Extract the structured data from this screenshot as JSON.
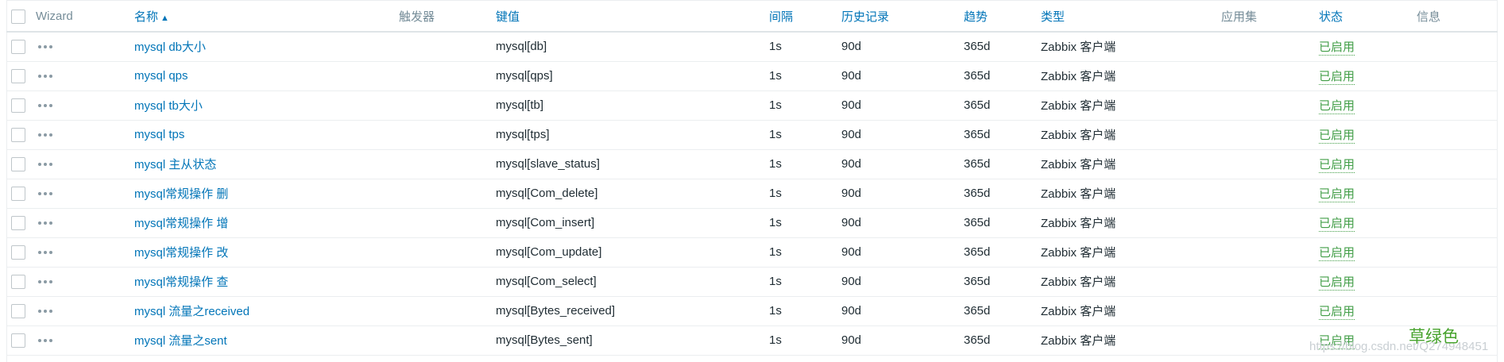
{
  "header": {
    "wizard": "Wizard",
    "name": "名称",
    "name_sort": "▲",
    "triggers": "触发器",
    "key": "键值",
    "interval": "间隔",
    "history": "历史记录",
    "trends": "趋势",
    "type": "类型",
    "applications": "应用集",
    "status": "状态",
    "info": "信息"
  },
  "rows": [
    {
      "name": "mysql db大小",
      "key": "mysql[db]",
      "interval": "1s",
      "history": "90d",
      "trends": "365d",
      "type": "Zabbix 客户端",
      "status": "已启用"
    },
    {
      "name": "mysql qps",
      "key": "mysql[qps]",
      "interval": "1s",
      "history": "90d",
      "trends": "365d",
      "type": "Zabbix 客户端",
      "status": "已启用"
    },
    {
      "name": "mysql tb大小",
      "key": "mysql[tb]",
      "interval": "1s",
      "history": "90d",
      "trends": "365d",
      "type": "Zabbix 客户端",
      "status": "已启用"
    },
    {
      "name": "mysql tps",
      "key": "mysql[tps]",
      "interval": "1s",
      "history": "90d",
      "trends": "365d",
      "type": "Zabbix 客户端",
      "status": "已启用"
    },
    {
      "name": "mysql 主从状态",
      "key": "mysql[slave_status]",
      "interval": "1s",
      "history": "90d",
      "trends": "365d",
      "type": "Zabbix 客户端",
      "status": "已启用"
    },
    {
      "name": "mysql常规操作 删",
      "key": "mysql[Com_delete]",
      "interval": "1s",
      "history": "90d",
      "trends": "365d",
      "type": "Zabbix 客户端",
      "status": "已启用"
    },
    {
      "name": "mysql常规操作 增",
      "key": "mysql[Com_insert]",
      "interval": "1s",
      "history": "90d",
      "trends": "365d",
      "type": "Zabbix 客户端",
      "status": "已启用"
    },
    {
      "name": "mysql常规操作 改",
      "key": "mysql[Com_update]",
      "interval": "1s",
      "history": "90d",
      "trends": "365d",
      "type": "Zabbix 客户端",
      "status": "已启用"
    },
    {
      "name": "mysql常规操作 查",
      "key": "mysql[Com_select]",
      "interval": "1s",
      "history": "90d",
      "trends": "365d",
      "type": "Zabbix 客户端",
      "status": "已启用"
    },
    {
      "name": "mysql 流量之received",
      "key": "mysql[Bytes_received]",
      "interval": "1s",
      "history": "90d",
      "trends": "365d",
      "type": "Zabbix 客户端",
      "status": "已启用"
    },
    {
      "name": "mysql 流量之sent",
      "key": "mysql[Bytes_sent]",
      "interval": "1s",
      "history": "90d",
      "trends": "365d",
      "type": "Zabbix 客户端",
      "status": "已启用"
    }
  ],
  "watermark": {
    "url": "https://blog.csdn.net/Q274948451",
    "tag": "草绿色"
  },
  "colors": {
    "link": "#0275b8",
    "enabled": "#429e47",
    "header_plain": "#768d99"
  }
}
